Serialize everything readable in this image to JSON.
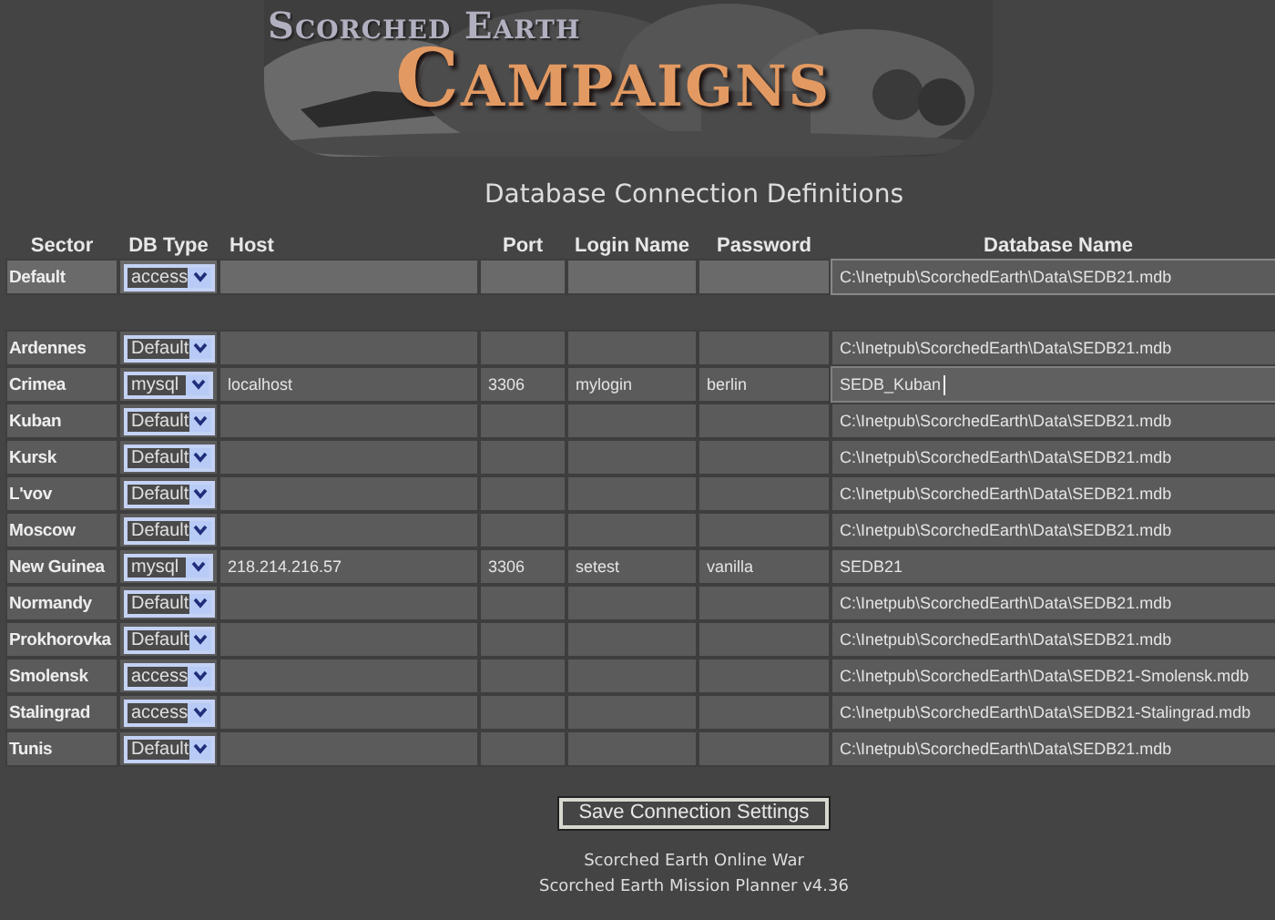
{
  "banner": {
    "title_top": "Scorched Earth",
    "title_main": "Campaigns"
  },
  "heading": "Database Connection Definitions",
  "columns": [
    "Sector",
    "DB Type",
    "Host",
    "Port",
    "Login Name",
    "Password",
    "Database Name"
  ],
  "default_row": {
    "sector": "Default",
    "db_type": "access",
    "database_name": "C:\\Inetpub\\ScorchedEarth\\Data\\SEDB21.mdb",
    "focused": false
  },
  "rows": [
    {
      "sector": "Ardennes",
      "db_type": "Default",
      "database_name": "C:\\Inetpub\\ScorchedEarth\\Data\\SEDB21.mdb",
      "focused": false
    },
    {
      "sector": "Crimea",
      "db_type": "mysql",
      "host": "localhost",
      "port": "3306",
      "login_name": "mylogin",
      "password": "berlin",
      "database_name": "SEDB_Kuban",
      "focused": true
    },
    {
      "sector": "Kuban",
      "db_type": "Default",
      "database_name": "C:\\Inetpub\\ScorchedEarth\\Data\\SEDB21.mdb",
      "focused": false
    },
    {
      "sector": "Kursk",
      "db_type": "Default",
      "database_name": "C:\\Inetpub\\ScorchedEarth\\Data\\SEDB21.mdb",
      "focused": false
    },
    {
      "sector": "L'vov",
      "db_type": "Default",
      "database_name": "C:\\Inetpub\\ScorchedEarth\\Data\\SEDB21.mdb",
      "focused": false
    },
    {
      "sector": "Moscow",
      "db_type": "Default",
      "database_name": "C:\\Inetpub\\ScorchedEarth\\Data\\SEDB21.mdb",
      "focused": false
    },
    {
      "sector": "New Guinea",
      "db_type": "mysql",
      "host": "218.214.216.57",
      "port": "3306",
      "login_name": "setest",
      "password": "vanilla",
      "database_name": "SEDB21",
      "focused": false
    },
    {
      "sector": "Normandy",
      "db_type": "Default",
      "database_name": "C:\\Inetpub\\ScorchedEarth\\Data\\SEDB21.mdb",
      "focused": false
    },
    {
      "sector": "Prokhorovka",
      "db_type": "Default",
      "database_name": "C:\\Inetpub\\ScorchedEarth\\Data\\SEDB21.mdb",
      "focused": false
    },
    {
      "sector": "Smolensk",
      "db_type": "access",
      "database_name": "C:\\Inetpub\\ScorchedEarth\\Data\\SEDB21-Smolensk.mdb",
      "focused": false
    },
    {
      "sector": "Stalingrad",
      "db_type": "access",
      "database_name": "C:\\Inetpub\\ScorchedEarth\\Data\\SEDB21-Stalingrad.mdb",
      "focused": false
    },
    {
      "sector": "Tunis",
      "db_type": "Default",
      "database_name": "C:\\Inetpub\\ScorchedEarth\\Data\\SEDB21.mdb",
      "focused": false
    }
  ],
  "save_button": "Save Connection Settings",
  "footer": [
    "Scorched Earth Online War",
    "Scorched Earth Mission Planner v4.36"
  ]
}
